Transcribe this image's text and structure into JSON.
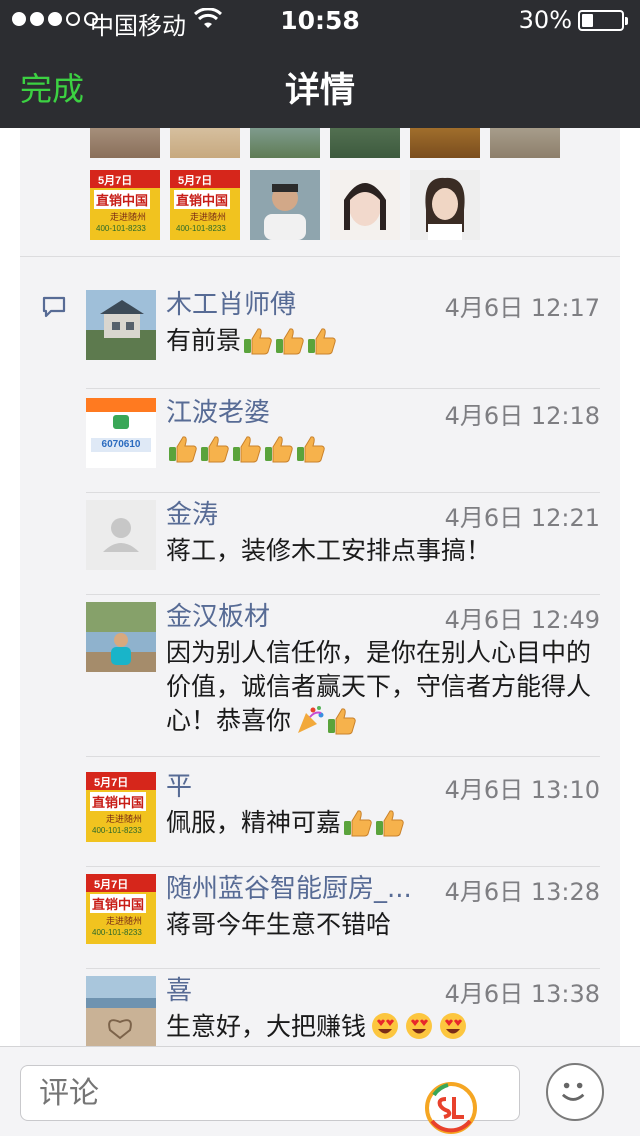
{
  "status_bar": {
    "carrier": "中国移动",
    "time": "10:58",
    "battery": "30%",
    "battery_level": 0.3
  },
  "nav": {
    "done_label": "完成",
    "title": "详情"
  },
  "comments": [
    {
      "name": "木工肖师傅",
      "time": "4月6日 12:17",
      "text": "有前景",
      "thumbs": 3,
      "party": 0,
      "grin": 0
    },
    {
      "name": "江波老婆",
      "time": "4月6日 12:18",
      "text": "",
      "thumbs": 5,
      "party": 0,
      "grin": 0
    },
    {
      "name": "金涛",
      "time": "4月6日 12:21",
      "text": "蒋工，装修木工安排点事搞！",
      "thumbs": 0,
      "party": 0,
      "grin": 0
    },
    {
      "name": "金汉板材",
      "time": "4月6日 12:49",
      "text": "因为别人信任你，是你在别人心目中的价值，诚信者赢天下，守信者方能得人心！恭喜你",
      "thumbs": 1,
      "party": 1,
      "grin": 0
    },
    {
      "name": "平",
      "time": "4月6日 13:10",
      "text": "佩服，精神可嘉",
      "thumbs": 2,
      "party": 0,
      "grin": 0
    },
    {
      "name": "随州蓝谷智能厨房_...",
      "time": "4月6日 13:28",
      "text": "蒋哥今年生意不错哈",
      "thumbs": 0,
      "party": 0,
      "grin": 0
    },
    {
      "name": "喜",
      "time": "4月6日 13:38",
      "text": "生意好，大把赚钱",
      "thumbs": 0,
      "party": 0,
      "grin": 3
    }
  ],
  "poster_avatar": {
    "date": "5月7日",
    "title": "直销中国",
    "sub": "走进随州",
    "phone": "400-101-8233"
  },
  "card_avatar": {
    "phone": "6070610"
  },
  "input": {
    "placeholder": "评论"
  },
  "colors": {
    "nav_bg": "#2c2d31",
    "done_green": "#3cd142",
    "name_blue": "#576b95",
    "card_bg": "#f3f3f5"
  }
}
